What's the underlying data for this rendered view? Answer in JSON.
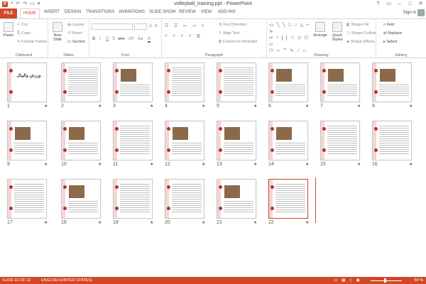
{
  "window": {
    "title": "volleyball_training.ppt - PowerPoint",
    "app_icon": "P",
    "qat": [
      "save-icon",
      "undo-icon",
      "redo-icon",
      "slideshow-icon",
      "customize-icon"
    ],
    "controls": [
      "?",
      "▭",
      "–",
      "□",
      "✕"
    ]
  },
  "tabs": {
    "file": "FILE",
    "items": [
      "HOME",
      "INSERT",
      "DESIGN",
      "TRANSITIONS",
      "ANIMATIONS",
      "SLIDE SHOW",
      "REVIEW",
      "VIEW",
      "ADD-INS"
    ],
    "active": "HOME",
    "signin": "Sign in"
  },
  "ribbon": {
    "clipboard": {
      "label": "Clipboard",
      "paste": "Paste",
      "cut": "Cut",
      "copy": "Copy",
      "format_painter": "Format Painter"
    },
    "slides": {
      "label": "Slides",
      "new_slide": "New Slide",
      "layout": "Layout",
      "reset": "Reset",
      "section": "Section"
    },
    "font": {
      "label": "Font",
      "buttons": [
        "B",
        "I",
        "U",
        "S",
        "abc",
        "AV",
        "Aa",
        "A"
      ]
    },
    "paragraph": {
      "label": "Paragraph",
      "text_direction": "Text Direction",
      "align_text": "Align Text",
      "convert_smartart": "Convert to SmartArt"
    },
    "drawing": {
      "label": "Drawing",
      "arrange": "Arrange",
      "quick_styles": "Quick Styles",
      "shape_fill": "Shape Fill",
      "shape_outline": "Shape Outline",
      "shape_effects": "Shape Effects"
    },
    "editing": {
      "label": "Editing",
      "find": "Find",
      "replace": "Replace",
      "select": "Select"
    }
  },
  "slides": [
    {
      "num": "1",
      "title": "ورزش والیبال"
    },
    {
      "num": "2"
    },
    {
      "num": "3"
    },
    {
      "num": "4"
    },
    {
      "num": "5"
    },
    {
      "num": "6"
    },
    {
      "num": "7"
    },
    {
      "num": "8"
    },
    {
      "num": "9"
    },
    {
      "num": "10"
    },
    {
      "num": "11"
    },
    {
      "num": "12"
    },
    {
      "num": "13"
    },
    {
      "num": "14"
    },
    {
      "num": "15"
    },
    {
      "num": "16"
    },
    {
      "num": "17"
    },
    {
      "num": "18"
    },
    {
      "num": "19"
    },
    {
      "num": "20"
    },
    {
      "num": "21"
    },
    {
      "num": "22"
    }
  ],
  "status": {
    "slide": "SLIDE 22 OF 22",
    "language": "ENGLISH (UNITED STATES)",
    "zoom": "54 %"
  },
  "colors": {
    "accent": "#d24726",
    "slide_circle": "#b5332a"
  }
}
